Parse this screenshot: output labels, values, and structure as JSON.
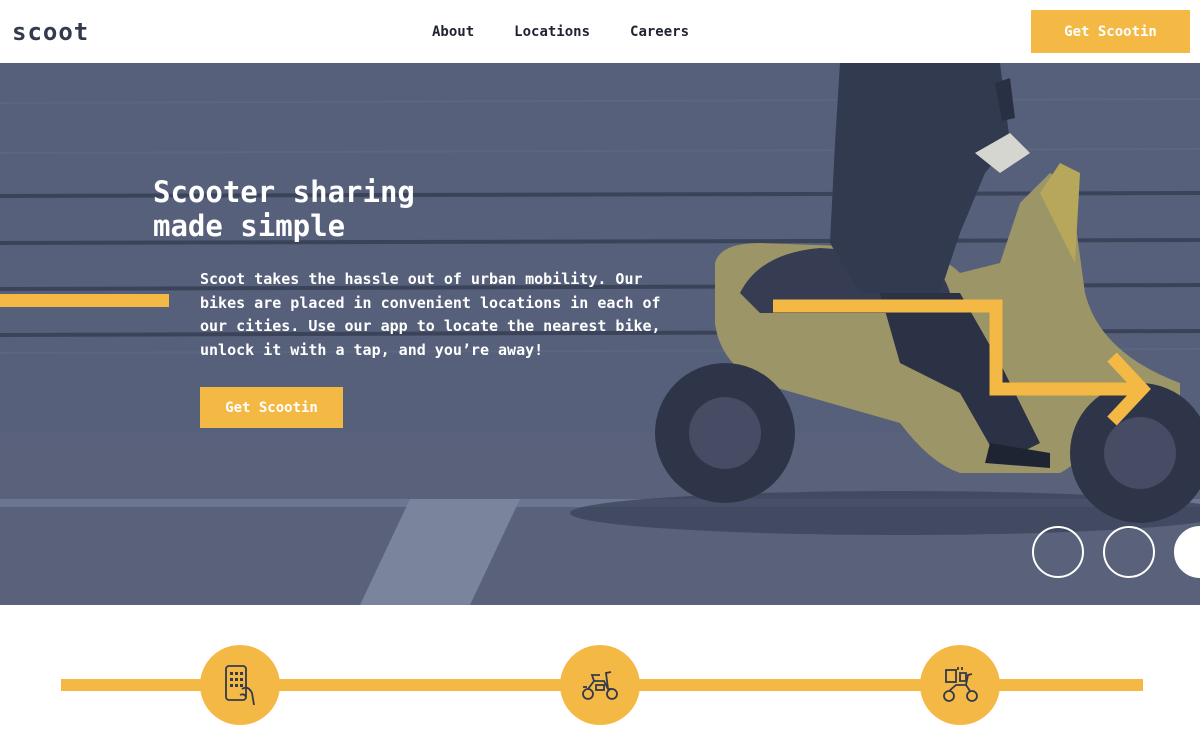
{
  "brand": {
    "logo": "scoot"
  },
  "nav": {
    "items": [
      "About",
      "Locations",
      "Careers"
    ],
    "cta": "Get Scootin"
  },
  "hero": {
    "title_line1": "Scooter sharing",
    "title_line2": "made simple",
    "text": "Scoot takes the hassle out of urban mobility. Our bikes are placed in convenient locations in each of our cities. Use our app to locate the nearest bike, unlock it with a tap, and you’re away!",
    "cta": "Get Scootin"
  },
  "carousel": {
    "count": 3,
    "active_index": 2
  },
  "steps": {
    "icons": [
      "phone-app-icon",
      "scooter-icon",
      "scooter-delivery-icon"
    ]
  },
  "colors": {
    "accent": "#f4b844",
    "navy": "#333a4d",
    "hero_overlay": "#4a5470",
    "white": "#ffffff"
  }
}
